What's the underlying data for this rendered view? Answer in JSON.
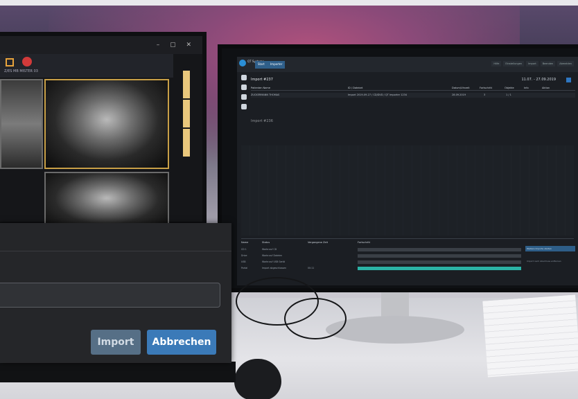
{
  "dialog": {
    "import_label": "Import",
    "cancel_label": "Abbrechen",
    "input_value": ""
  },
  "left_monitor": {
    "toolbar_text": "Z/ES   MB  MISTER 03"
  },
  "right_monitor": {
    "brand": "QT Systems",
    "tabs": [
      "Start",
      "Importer"
    ],
    "top_right_buttons": [
      "Hilfe",
      "Einstellungen",
      "Import",
      "Beenden",
      "Abmelden"
    ],
    "panel_title": "Import #237",
    "date": "11.07. - 27.09.2019",
    "table_headers": [
      "Patienten Name",
      "ID / Dateiart",
      "Datum/Uhrzeit",
      "Fortschritt",
      "Objekte",
      "Info",
      "Aktion"
    ],
    "table_row": [
      "ZUCKERMANN THOMAS",
      "Import 2019-09-27 / CD/DVD / QT Importer 1234",
      "28.09.2019",
      "3",
      "1 / 1",
      "",
      ""
    ],
    "panel2_title": "Import #236",
    "status_headers": [
      "Name",
      "Status",
      "Vergangene Zeit",
      "Fortschritt"
    ],
    "status_rows": [
      {
        "name": "CD 1",
        "status": "Warte auf CD",
        "time": ""
      },
      {
        "name": "Drive",
        "status": "Warte auf Dateien",
        "time": ""
      },
      {
        "name": "USB",
        "status": "Warte auf USB Gerät",
        "time": ""
      },
      {
        "name": "Portal",
        "status": "Import abgeschlossen",
        "time": "00:11"
      }
    ],
    "status_progress": [
      0,
      0,
      0,
      1
    ],
    "action_label": "Weitere Importe starten",
    "action_label_secondary": "Import nach Abschluss entfernen"
  }
}
